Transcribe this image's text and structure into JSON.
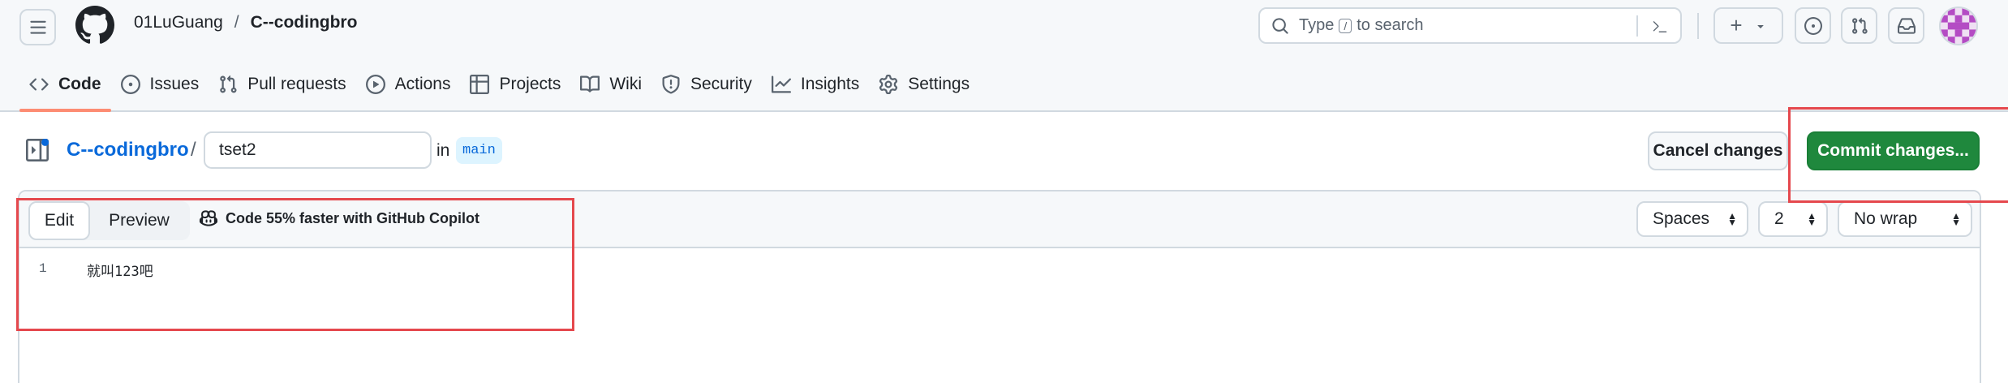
{
  "header": {
    "owner": "01LuGuang",
    "separator": "/",
    "repo": "C--codingbro",
    "search": {
      "prefix": "Type",
      "key": "/",
      "suffix": "to search"
    },
    "create_symbol": "+"
  },
  "nav": {
    "items": [
      {
        "label": "Code",
        "icon": "code-icon",
        "selected": true
      },
      {
        "label": "Issues",
        "icon": "issue-icon"
      },
      {
        "label": "Pull requests",
        "icon": "pull-request-icon"
      },
      {
        "label": "Actions",
        "icon": "play-icon"
      },
      {
        "label": "Projects",
        "icon": "table-icon"
      },
      {
        "label": "Wiki",
        "icon": "book-icon"
      },
      {
        "label": "Security",
        "icon": "shield-icon"
      },
      {
        "label": "Insights",
        "icon": "graph-icon"
      },
      {
        "label": "Settings",
        "icon": "gear-icon"
      }
    ]
  },
  "breadcrumb": {
    "repo": "C--codingbro",
    "slash": "/",
    "filename": "tset2",
    "in_label": "in",
    "branch": "main"
  },
  "actions": {
    "cancel": "Cancel changes",
    "commit": "Commit changes..."
  },
  "editor": {
    "tab_edit": "Edit",
    "tab_preview": "Preview",
    "copilot": "Code 55% faster with GitHub Copilot",
    "indent_mode": "Spaces",
    "indent_size": "2",
    "wrap_mode": "No wrap",
    "lines": [
      {
        "number": "1",
        "text": "就叫123吧"
      }
    ]
  },
  "colors": {
    "accent_blue": "#0969da",
    "commit_green": "#1f883d",
    "nav_underline": "#fd8c73",
    "annotation_red": "#e5484d"
  }
}
